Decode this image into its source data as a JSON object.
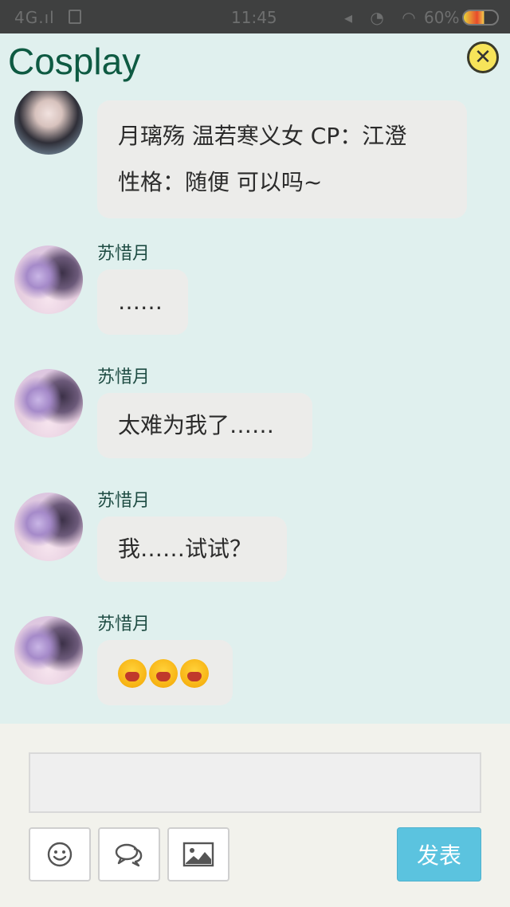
{
  "status_bar": {
    "network": "4G.ıl",
    "time": "11:45",
    "battery_text": "60%"
  },
  "header": {
    "title": "Cosplay",
    "close_icon": "close-icon"
  },
  "messages": [
    {
      "sender": "",
      "lines": [
        "月璃殇 温若寒义女 CP：江澄",
        "性格：随便 可以吗~"
      ]
    },
    {
      "sender": "苏惜月",
      "lines": [
        "……"
      ]
    },
    {
      "sender": "苏惜月",
      "lines": [
        "太难为我了……"
      ]
    },
    {
      "sender": "苏惜月",
      "lines": [
        "我……试试？"
      ]
    },
    {
      "sender": "苏惜月",
      "lines": [],
      "emoji": [
        "crying-face-emoji",
        "crying-face-emoji",
        "crying-face-emoji"
      ]
    }
  ],
  "composer": {
    "input_value": "",
    "tools": [
      "smiley-icon",
      "chat-bubbles-icon",
      "image-icon"
    ],
    "send_label": "发表"
  },
  "colors": {
    "chat_background": "#e0f0ee",
    "title_color": "#0e5a42",
    "bubble": "#ececea",
    "send_button": "#5bc3df",
    "close_button": "#f7e45a"
  }
}
